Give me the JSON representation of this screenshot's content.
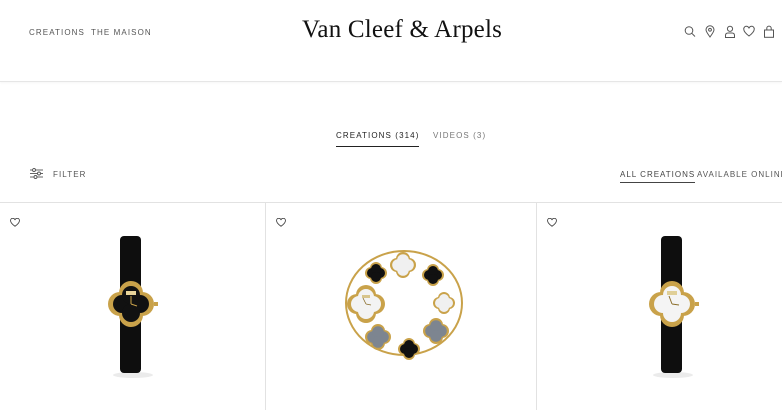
{
  "header": {
    "nav": [
      {
        "label": "CREATIONS"
      },
      {
        "label": "THE MAISON"
      }
    ],
    "logo": "Van Cleef & Arpels",
    "icons": [
      "search-icon",
      "location-pin-icon",
      "user-icon",
      "heart-icon",
      "shopping-bag-icon"
    ]
  },
  "tabs": {
    "creations": "CREATIONS (314)",
    "videos": "VIDEOS (3)"
  },
  "toolbar": {
    "filter_label": "FILTER",
    "all_creations": "ALL CREATIONS",
    "available_online": "AVAILABLE ONLINE"
  },
  "products": [
    {
      "image": "black-strap-watch-onyx-clover-dial",
      "favorite_icon": "heart-outline-icon"
    },
    {
      "image": "gold-clover-bracelet-watch-onyx-mother-of-pearl",
      "favorite_icon": "heart-outline-icon"
    },
    {
      "image": "black-strap-watch-white-mother-of-pearl-clover-dial",
      "favorite_icon": "heart-outline-icon"
    }
  ],
  "colors": {
    "gold": "#c9a24a",
    "onyx": "#111111",
    "mother_of_pearl": "#eeeeee",
    "grey_mother_of_pearl": "#7d8590"
  }
}
